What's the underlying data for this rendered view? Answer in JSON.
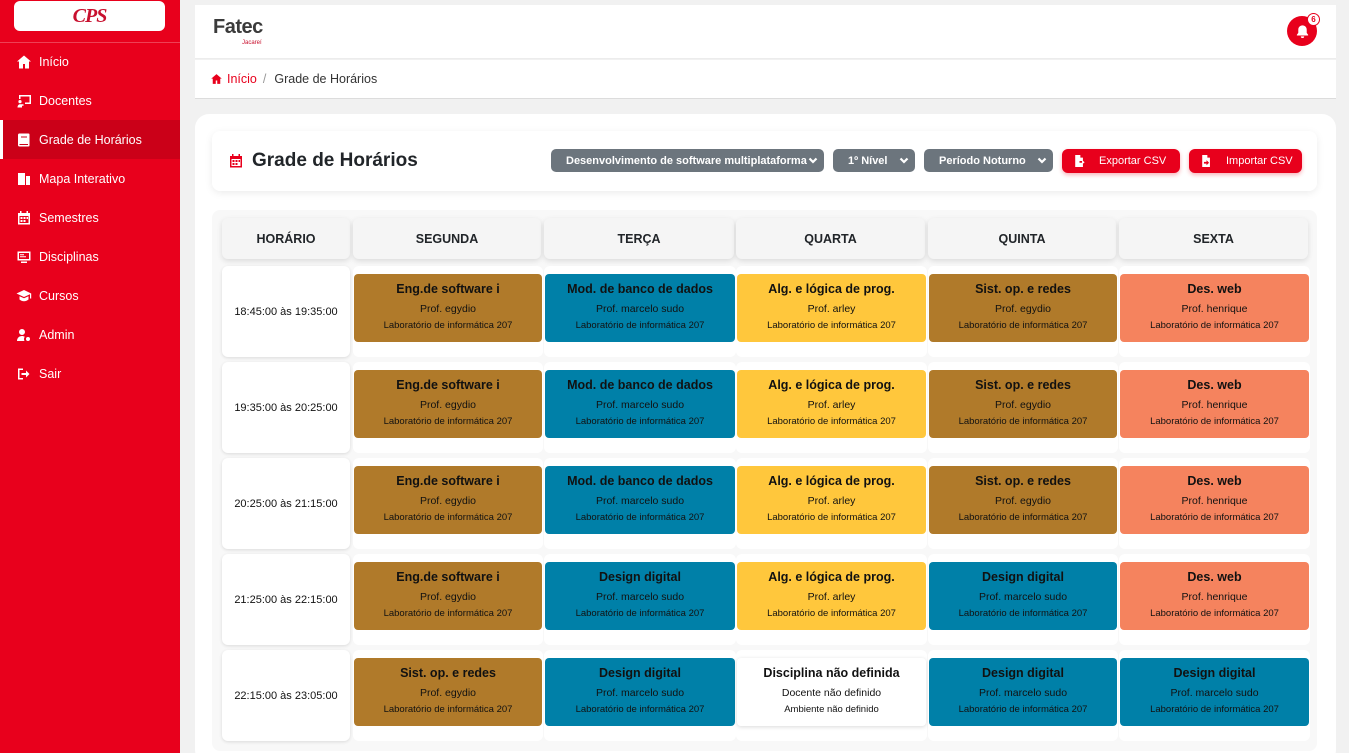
{
  "sidebar": {
    "logo": "CPS",
    "items": [
      {
        "label": "Início",
        "icon": "home-icon"
      },
      {
        "label": "Docentes",
        "icon": "chalkboard-teacher-icon"
      },
      {
        "label": "Grade de Horários",
        "icon": "book-icon",
        "active": true
      },
      {
        "label": "Mapa Interativo",
        "icon": "building-icon"
      },
      {
        "label": "Semestres",
        "icon": "calendar-icon"
      },
      {
        "label": "Disciplinas",
        "icon": "screen-icon"
      },
      {
        "label": "Cursos",
        "icon": "graduation-cap-icon"
      },
      {
        "label": "Admin",
        "icon": "user-gear-icon"
      },
      {
        "label": "Sair",
        "icon": "sign-out-icon"
      }
    ]
  },
  "header": {
    "brand": "Fatec",
    "brand_sub": "Jacareí",
    "notification_count": "6"
  },
  "breadcrumb": {
    "home": "Início",
    "separator": "/",
    "current": "Grade de Horários"
  },
  "toolbar": {
    "title": "Grade de Horários",
    "course_select": "Desenvolvimento de software multiplataforma",
    "level_select": "1º Nível",
    "period_select": "Período Noturno",
    "export_label": "Exportar CSV",
    "import_label": "Importar CSV"
  },
  "schedule": {
    "headers": [
      "HORÁRIO",
      "SEGUNDA",
      "TERÇA",
      "QUARTA",
      "QUINTA",
      "SEXTA"
    ],
    "rows": [
      {
        "time": "18:45:00 às 19:35:00",
        "slots": [
          {
            "subject": "Eng.de software i",
            "prof": "Prof. egydio",
            "room": "Laboratório de informática 207",
            "color": "brown"
          },
          {
            "subject": "Mod. de banco de dados",
            "prof": "Prof. marcelo sudo",
            "room": "Laboratório de informática 207",
            "color": "blue"
          },
          {
            "subject": "Alg. e lógica de prog.",
            "prof": "Prof. arley",
            "room": "Laboratório de informática 207",
            "color": "yellow"
          },
          {
            "subject": "Sist. op. e redes",
            "prof": "Prof. egydio",
            "room": "Laboratório de informática 207",
            "color": "brown"
          },
          {
            "subject": "Des. web",
            "prof": "Prof. henrique",
            "room": "Laboratório de informática 207",
            "color": "salmon"
          }
        ]
      },
      {
        "time": "19:35:00 às 20:25:00",
        "slots": [
          {
            "subject": "Eng.de software i",
            "prof": "Prof. egydio",
            "room": "Laboratório de informática 207",
            "color": "brown"
          },
          {
            "subject": "Mod. de banco de dados",
            "prof": "Prof. marcelo sudo",
            "room": "Laboratório de informática 207",
            "color": "blue"
          },
          {
            "subject": "Alg. e lógica de prog.",
            "prof": "Prof. arley",
            "room": "Laboratório de informática 207",
            "color": "yellow"
          },
          {
            "subject": "Sist. op. e redes",
            "prof": "Prof. egydio",
            "room": "Laboratório de informática 207",
            "color": "brown"
          },
          {
            "subject": "Des. web",
            "prof": "Prof. henrique",
            "room": "Laboratório de informática 207",
            "color": "salmon"
          }
        ]
      },
      {
        "time": "20:25:00 às 21:15:00",
        "slots": [
          {
            "subject": "Eng.de software i",
            "prof": "Prof. egydio",
            "room": "Laboratório de informática 207",
            "color": "brown"
          },
          {
            "subject": "Mod. de banco de dados",
            "prof": "Prof. marcelo sudo",
            "room": "Laboratório de informática 207",
            "color": "blue"
          },
          {
            "subject": "Alg. e lógica de prog.",
            "prof": "Prof. arley",
            "room": "Laboratório de informática 207",
            "color": "yellow"
          },
          {
            "subject": "Sist. op. e redes",
            "prof": "Prof. egydio",
            "room": "Laboratório de informática 207",
            "color": "brown"
          },
          {
            "subject": "Des. web",
            "prof": "Prof. henrique",
            "room": "Laboratório de informática 207",
            "color": "salmon"
          }
        ]
      },
      {
        "time": "21:25:00 às 22:15:00",
        "slots": [
          {
            "subject": "Eng.de software i",
            "prof": "Prof. egydio",
            "room": "Laboratório de informática 207",
            "color": "brown"
          },
          {
            "subject": "Design digital",
            "prof": "Prof. marcelo sudo",
            "room": "Laboratório de informática 207",
            "color": "blue"
          },
          {
            "subject": "Alg. e lógica de prog.",
            "prof": "Prof. arley",
            "room": "Laboratório de informática 207",
            "color": "yellow"
          },
          {
            "subject": "Design digital",
            "prof": "Prof. marcelo sudo",
            "room": "Laboratório de informática 207",
            "color": "blue"
          },
          {
            "subject": "Des. web",
            "prof": "Prof. henrique",
            "room": "Laboratório de informática 207",
            "color": "salmon"
          }
        ]
      },
      {
        "time": "22:15:00 às 23:05:00",
        "slots": [
          {
            "subject": "Sist. op. e redes",
            "prof": "Prof. egydio",
            "room": "Laboratório de informática 207",
            "color": "brown"
          },
          {
            "subject": "Design digital",
            "prof": "Prof. marcelo sudo",
            "room": "Laboratório de informática 207",
            "color": "blue"
          },
          {
            "subject": "Disciplina não definida",
            "prof": "Docente não definido",
            "room": "Ambiente não definido",
            "color": "white"
          },
          {
            "subject": "Design digital",
            "prof": "Prof. marcelo sudo",
            "room": "Laboratório de informática 207",
            "color": "blue"
          },
          {
            "subject": "Design digital",
            "prof": "Prof. marcelo sudo",
            "room": "Laboratório de informática 207",
            "color": "blue"
          }
        ]
      }
    ]
  },
  "colors": {
    "primary": "#e8001c",
    "brown": "#b07a2a",
    "blue": "#0080a8",
    "yellow": "#ffc73c",
    "salmon": "#f5835e",
    "white": "#ffffff"
  }
}
